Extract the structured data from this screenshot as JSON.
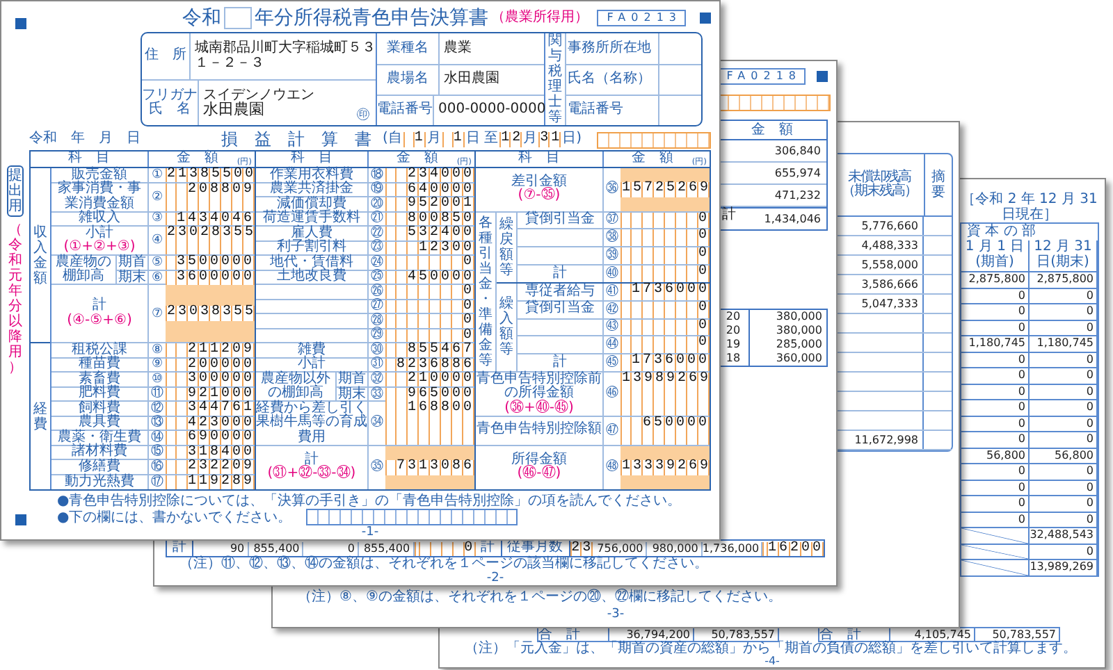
{
  "page_4": {
    "date": "［令和 2 年 12 月 31 日現在］",
    "section": "資 本 の 部",
    "columns": [
      "1 月 1 日(期首)",
      "12 月 31 日(期末)"
    ],
    "rows": [
      [
        "2,875,800",
        "2,875,800"
      ],
      [
        "0",
        "0"
      ],
      [
        "0",
        "0"
      ],
      [
        "0",
        "0"
      ],
      [
        "1,180,745",
        "1,180,745"
      ],
      [
        "0",
        "0"
      ],
      [
        "0",
        "0"
      ],
      [
        "0",
        "0"
      ],
      [
        "0",
        "0"
      ],
      [
        "0",
        "0"
      ],
      [
        "0",
        "0"
      ],
      [
        "56,800",
        "56,800"
      ],
      [
        "0",
        "0"
      ],
      [
        "0",
        "0"
      ],
      [
        "0",
        "0"
      ],
      [
        "0",
        "0"
      ]
    ],
    "single_rows": [
      "32,488,543",
      "0",
      "13,989,269"
    ],
    "totals": [
      {
        "label": "合　計",
        "values": [
          "36,794,200",
          "50,783,557"
        ]
      },
      {
        "label": "合　計",
        "values": [
          "4,105,745",
          "50,783,557"
        ]
      }
    ],
    "note": "（注）「元入金」は、「期首の資産の総額」から「期首の負債の総額」を差し引いて計算します。",
    "page_number": "-4-"
  },
  "page_3": {
    "column_heading": "未償却残高",
    "column_subheading": "（期末残高）",
    "remarks_heading": "摘要",
    "values": [
      "5,776,660",
      "4,488,333",
      "5,558,000",
      "3,586,666",
      "5,047,333"
    ],
    "total": "11,672,998",
    "note": "（注）⑧、⑨の金額は、それぞれを１ページの⑳、㉒欄に移記してください。",
    "page_number": "-3-"
  },
  "page_2": {
    "code": "FA0218",
    "amount_heading": "金　額",
    "amounts": [
      "306,840",
      "655,974",
      "471,232"
    ],
    "total_label": "計",
    "total": "1,434,046",
    "wages": [
      [
        "20",
        "380,000"
      ],
      [
        "20",
        "380,000"
      ],
      [
        "19",
        "285,000"
      ],
      [
        "18",
        "360,000"
      ]
    ],
    "bottom_row": [
      {
        "kind": "label",
        "text": "計"
      },
      {
        "kind": "num",
        "text": "90"
      },
      {
        "kind": "num",
        "text": "855,400"
      },
      {
        "kind": "num",
        "text": "0"
      },
      {
        "kind": "num",
        "text": "855,400"
      },
      {
        "kind": "digits",
        "text": "0"
      },
      {
        "kind": "label",
        "text": "計"
      },
      {
        "kind": "label",
        "text": "従事月数"
      },
      {
        "kind": "count",
        "text": "23"
      },
      {
        "kind": "num",
        "text": "756,000"
      },
      {
        "kind": "num",
        "text": "980,000"
      },
      {
        "kind": "num",
        "text": "1,736,000"
      },
      {
        "kind": "digits",
        "text": "16200"
      }
    ],
    "note": "（注）⑪、⑫、⑬、⑭の金額は、それぞれを１ページの該当欄に移記してください。",
    "page_number": "-2-"
  },
  "page_1": {
    "code": "FA0213",
    "title_prefix": "令和",
    "title": "年分所得税青色申告決算書",
    "title_tag": "（農業所得用）",
    "side_tab": "提出用",
    "side_note": "（令和元年分以降用）",
    "applicant": {
      "address_label": "住　所",
      "address": "城南郡品川町大字稲城町５３",
      "address_2": "１－２－３",
      "furigana_label": "フリガナ",
      "furigana": "スイデンノウエン",
      "name_label": "氏　名",
      "name": "水田農園",
      "seal": "㊞",
      "fields": [
        {
          "label": "業種名",
          "value": "農業"
        },
        {
          "label": "農場名",
          "value": "水田農園"
        },
        {
          "label": "電話番号",
          "value": "000-0000-0000"
        }
      ],
      "agent_label": "関与税理士等",
      "agent_fields": [
        "事務所所在地",
        "氏名（名称）",
        "電話番号"
      ]
    },
    "date_line": "令和　年　月　日",
    "statement_title": "損　益　計　算　書",
    "period": [
      {
        "kind": "text",
        "text": "(自"
      },
      {
        "kind": "box",
        "text": "1"
      },
      {
        "kind": "text",
        "text": "月"
      },
      {
        "kind": "box",
        "text": "1"
      },
      {
        "kind": "text",
        "text": "日 至"
      },
      {
        "kind": "box",
        "text": "12"
      },
      {
        "kind": "text",
        "text": "月"
      },
      {
        "kind": "box",
        "text": "31"
      },
      {
        "kind": "text",
        "text": "日)"
      }
    ],
    "sections": [
      {
        "header": {
          "item": "科　目",
          "amount": "金　額",
          "unit": "(円)"
        },
        "groups": [
          {
            "label": "収入金額",
            "rows": [
              {
                "kind": "item",
                "label": "販売金額",
                "no": "①",
                "value": "21385500"
              },
              {
                "kind": "tall",
                "label": "家事消費・事業消費金額",
                "no": "②",
                "value": "208809"
              },
              {
                "kind": "item",
                "label": "雑収入",
                "no": "③",
                "value": "1434046"
              },
              {
                "kind": "tall",
                "label": "小計",
                "formula": "(①+②+③)",
                "no": "④",
                "value": "23028355"
              },
              {
                "kind": "pair",
                "label": "農産物の棚卸高",
                "rows": [
                  {
                    "sub": "期首",
                    "no": "⑤",
                    "value": "3500000"
                  },
                  {
                    "sub": "期末",
                    "no": "⑥",
                    "value": "3600000"
                  }
                ]
              },
              {
                "kind": "grand",
                "label": "計",
                "formula": "(④-⑤+⑥)",
                "no": "⑦",
                "value": "23038355"
              }
            ]
          },
          {
            "label": "経費",
            "rows": [
              {
                "kind": "item",
                "label": "租税公課",
                "no": "⑧",
                "value": "211209"
              },
              {
                "kind": "item",
                "label": "種苗費",
                "no": "⑨",
                "value": "200000"
              },
              {
                "kind": "item",
                "label": "素畜費",
                "no": "⑩",
                "value": "300000"
              },
              {
                "kind": "item",
                "label": "肥料費",
                "no": "⑪",
                "value": "921000"
              },
              {
                "kind": "item",
                "label": "飼料費",
                "no": "⑫",
                "value": "344761"
              },
              {
                "kind": "item",
                "label": "農具費",
                "no": "⑬",
                "value": "423000"
              },
              {
                "kind": "item",
                "label": "農薬・衛生費",
                "no": "⑭",
                "value": "690000"
              },
              {
                "kind": "item",
                "label": "諸材料費",
                "no": "⑮",
                "value": "318400"
              },
              {
                "kind": "item",
                "label": "修繕費",
                "no": "⑯",
                "value": "232209"
              },
              {
                "kind": "item",
                "label": "動力光熱費",
                "no": "⑰",
                "value": "119289"
              }
            ]
          }
        ]
      },
      {
        "header": {
          "item": "科　目",
          "amount": "金　額",
          "unit": "(円)"
        },
        "rows": [
          {
            "kind": "item",
            "label": "作業用衣料費",
            "no": "⑱",
            "value": "234000"
          },
          {
            "kind": "item",
            "label": "農業共済掛金",
            "no": "⑲",
            "value": "640000"
          },
          {
            "kind": "item",
            "label": "減価償却費",
            "no": "⑳",
            "value": "952001"
          },
          {
            "kind": "item",
            "label": "荷造運賃手数料",
            "no": "㉑",
            "value": "800850"
          },
          {
            "kind": "item",
            "label": "雇人費",
            "no": "㉒",
            "value": "532400"
          },
          {
            "kind": "item",
            "label": "利子割引料",
            "no": "㉓",
            "value": "12300"
          },
          {
            "kind": "item",
            "label": "地代・賃借料",
            "no": "㉔",
            "value": "0"
          },
          {
            "kind": "item",
            "label": "土地改良費",
            "no": "㉕",
            "value": "450000"
          },
          {
            "kind": "item",
            "no": "㉖",
            "value": "0"
          },
          {
            "kind": "item",
            "no": "㉗",
            "value": "0"
          },
          {
            "kind": "item",
            "no": "㉘",
            "value": "0"
          },
          {
            "kind": "item",
            "no": "㉙",
            "value": "0"
          },
          {
            "kind": "item",
            "label": "雑費",
            "no": "㉚",
            "value": "855467"
          },
          {
            "kind": "item",
            "label": "小計",
            "no": "㉛",
            "value": "8236886"
          },
          {
            "kind": "pair",
            "label": "農産物以外の棚卸高",
            "rows": [
              {
                "sub": "期首",
                "no": "㉜",
                "value": "210000"
              },
              {
                "sub": "期末",
                "no": "㉝",
                "value": "965000"
              }
            ]
          },
          {
            "kind": "wide",
            "label": "経費から差し引く果樹牛馬等の育成費用",
            "no": "㉞",
            "value": "168800"
          },
          {
            "kind": "total",
            "label": "計",
            "formula": "(㉛+㉜-㉝-㉞)",
            "no": "㉟",
            "value": "7313086"
          }
        ]
      },
      {
        "header": {
          "item": "科　目",
          "amount": "金　額",
          "unit": "(円)"
        },
        "rows": [
          {
            "kind": "total",
            "label": "差引金額",
            "formula": "(⑦-㉟)",
            "no": "㊱",
            "value": "15725269"
          },
          {
            "kind": "group",
            "label": "各種引当金・準備金等",
            "groups": [
              {
                "label": "繰戻額等",
                "rows": [
                  {
                    "label": "貸倒引当金",
                    "no": "㊲",
                    "value": "0"
                  },
                  {
                    "no": "㊳",
                    "value": "0"
                  },
                  {
                    "no": "㊴",
                    "value": "0"
                  },
                  {
                    "label": "計",
                    "no": "㊵",
                    "value": "0"
                  }
                ]
              },
              {
                "label": "繰入額等",
                "rows": [
                  {
                    "label": "専従者給与",
                    "no": "㊶",
                    "value": "1736000"
                  },
                  {
                    "label": "貸倒引当金",
                    "no": "㊷",
                    "value": "0"
                  },
                  {
                    "no": "㊸",
                    "value": "0"
                  },
                  {
                    "no": "㊹",
                    "value": "0"
                  },
                  {
                    "label": "計",
                    "no": "㊺",
                    "value": "1736000"
                  }
                ]
              }
            ]
          },
          {
            "kind": "wide",
            "label": "青色申告特別控除前の所得金額",
            "formula": "(㊱+㊵-㊺)",
            "no": "㊻",
            "value": "13989269"
          },
          {
            "kind": "tall",
            "label": "青色申告特別控除額",
            "no": "㊼",
            "value": "650000"
          },
          {
            "kind": "total",
            "label": "所得金額",
            "formula": "(㊻-㊼)",
            "no": "㊽",
            "value": "13339269"
          }
        ]
      }
    ],
    "notes": [
      "●青色申告特別控除については、「決算の手引き」の「青色申告特別控除」の項を読んでください。",
      "●下の欄には、書かないでください。"
    ],
    "page_number": "-1-"
  }
}
